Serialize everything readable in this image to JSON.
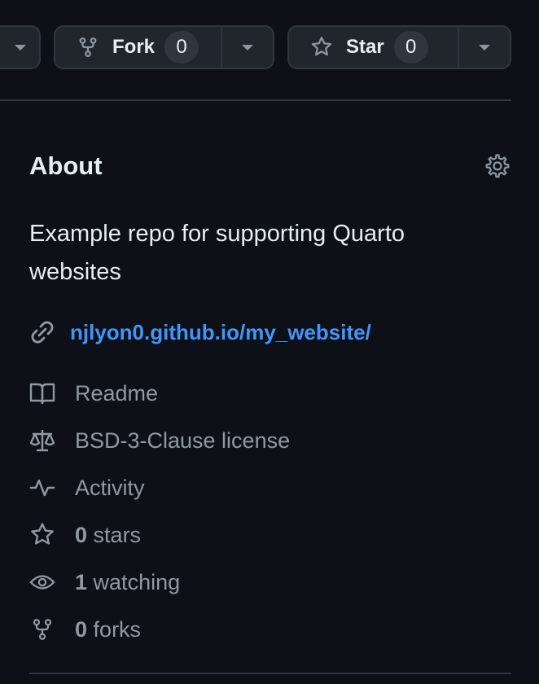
{
  "header": {
    "fork": {
      "label": "Fork",
      "count": "0",
      "icon": "fork-icon"
    },
    "star": {
      "label": "Star",
      "count": "0",
      "icon": "star-icon"
    }
  },
  "about": {
    "title": "About",
    "settings_icon": "gear-icon",
    "description": "Example repo for supporting Quarto websites",
    "website": "njlyon0.github.io/my_website/",
    "items": [
      {
        "icon": "book-icon",
        "text": "Readme"
      },
      {
        "icon": "law-icon",
        "text": "BSD-3-Clause license"
      },
      {
        "icon": "pulse-icon",
        "text": "Activity"
      },
      {
        "icon": "star-icon",
        "count": "0",
        "text": "stars"
      },
      {
        "icon": "eye-icon",
        "count": "1",
        "text": "watching"
      },
      {
        "icon": "fork-icon",
        "count": "0",
        "text": "forks"
      }
    ]
  },
  "colors": {
    "background": "#0d1117",
    "button_bg": "#21262d",
    "border": "#30363d",
    "text": "#e6edf3",
    "muted": "#9198a1",
    "link": "#4493f8"
  }
}
